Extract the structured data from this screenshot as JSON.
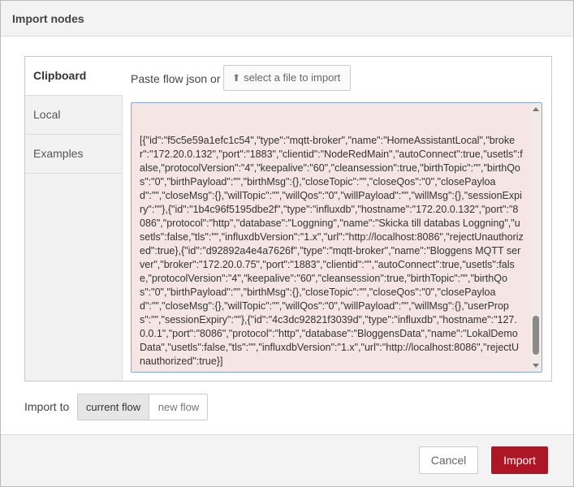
{
  "dialog": {
    "title": "Import nodes"
  },
  "tabs": [
    {
      "label": "Clipboard",
      "active": true
    },
    {
      "label": "Local",
      "active": false
    },
    {
      "label": "Examples",
      "active": false
    }
  ],
  "clipboard": {
    "paste_label": "Paste flow json or",
    "file_button_icon": "upload-icon",
    "file_button_label": "select a file to import",
    "json_text": "[{\"id\":\"f5c5e59a1efc1c54\",\"type\":\"mqtt-broker\",\"name\":\"HomeAssistantLocal\",\"broker\":\"172.20.0.132\",\"port\":\"1883\",\"clientid\":\"NodeRedMain\",\"autoConnect\":true,\"usetls\":false,\"protocolVersion\":\"4\",\"keepalive\":\"60\",\"cleansession\":true,\"birthTopic\":\"\",\"birthQos\":\"0\",\"birthPayload\":\"\",\"birthMsg\":{},\"closeTopic\":\"\",\"closeQos\":\"0\",\"closePayload\":\"\",\"closeMsg\":{},\"willTopic\":\"\",\"willQos\":\"0\",\"willPayload\":\"\",\"willMsg\":{},\"sessionExpiry\":\"\"},{\"id\":\"1b4c96f5195dbe2f\",\"type\":\"influxdb\",\"hostname\":\"172.20.0.132\",\"port\":\"8086\",\"protocol\":\"http\",\"database\":\"Loggning\",\"name\":\"Skicka till databas Loggning\",\"usetls\":false,\"tls\":\"\",\"influxdbVersion\":\"1.x\",\"url\":\"http://localhost:8086\",\"rejectUnauthorized\":true},{\"id\":\"d92892a4e4a7626f\",\"type\":\"mqtt-broker\",\"name\":\"Bloggens MQTT server\",\"broker\":\"172.20.0.75\",\"port\":\"1883\",\"clientid\":\"\",\"autoConnect\":true,\"usetls\":false,\"protocolVersion\":\"4\",\"keepalive\":\"60\",\"cleansession\":true,\"birthTopic\":\"\",\"birthQos\":\"0\",\"birthPayload\":\"\",\"birthMsg\":{},\"closeTopic\":\"\",\"closeQos\":\"0\",\"closePayload\":\"\",\"closeMsg\":{},\"willTopic\":\"\",\"willQos\":\"0\",\"willPayload\":\"\",\"willMsg\":{},\"userProps\":\"\",\"sessionExpiry\":\"\"},{\"id\":\"4c3dc92821f3039d\",\"type\":\"influxdb\",\"hostname\":\"127.0.0.1\",\"port\":\"8086\",\"protocol\":\"http\",\"database\":\"BloggensData\",\"name\":\"LokalDemoData\",\"usetls\":false,\"tls\":\"\",\"influxdbVersion\":\"1.x\",\"url\":\"http://localhost:8086\",\"rejectUnauthorized\":true}]"
  },
  "import_to": {
    "label": "Import to",
    "options": [
      {
        "label": "current flow",
        "selected": true
      },
      {
        "label": "new flow",
        "selected": false
      }
    ]
  },
  "footer": {
    "cancel_label": "Cancel",
    "import_label": "Import"
  },
  "colors": {
    "accent": "#ad1625",
    "json_background": "#f6e5e5",
    "json_border": "#86a8d6"
  }
}
